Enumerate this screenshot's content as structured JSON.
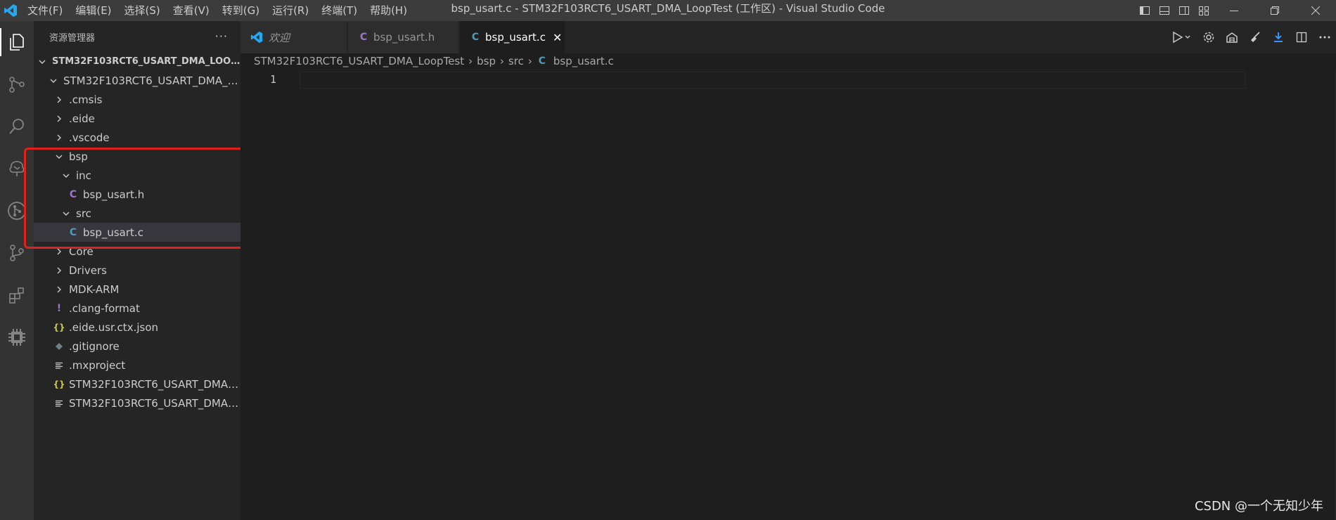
{
  "titlebar": {
    "menu": [
      "文件(F)",
      "编辑(E)",
      "选择(S)",
      "查看(V)",
      "转到(G)",
      "运行(R)",
      "终端(T)",
      "帮助(H)"
    ],
    "window_title": "bsp_usart.c - STM32F103RCT6_USART_DMA_LoopTest (工作区) - Visual Studio Code"
  },
  "sidebar": {
    "header": "资源管理器",
    "more": "···",
    "workspace_root": "STM32F103RCT6_USART_DMA_LOOPTE...",
    "folder_root": "STM32F103RCT6_USART_DMA_L...",
    "items": [
      {
        "label": ".cmsis",
        "type": "folder"
      },
      {
        "label": ".eide",
        "type": "folder"
      },
      {
        "label": ".vscode",
        "type": "folder"
      },
      {
        "label": "bsp",
        "type": "folder-open"
      },
      {
        "label": "inc",
        "type": "folder-open"
      },
      {
        "label": "bsp_usart.h",
        "type": "c-header",
        "icon_text": "C"
      },
      {
        "label": "src",
        "type": "folder-open"
      },
      {
        "label": "bsp_usart.c",
        "type": "c-source",
        "icon_text": "C"
      },
      {
        "label": "Core",
        "type": "folder"
      },
      {
        "label": "Drivers",
        "type": "folder"
      },
      {
        "label": "MDK-ARM",
        "type": "folder"
      },
      {
        "label": ".clang-format",
        "type": "file",
        "icon_text": "!"
      },
      {
        "label": ".eide.usr.ctx.json",
        "type": "json",
        "icon_text": "{}"
      },
      {
        "label": ".gitignore",
        "type": "git"
      },
      {
        "label": ".mxproject",
        "type": "text"
      },
      {
        "label": "STM32F103RCT6_USART_DMA_...",
        "type": "json",
        "icon_text": "{}"
      },
      {
        "label": "STM32F103RCT6_USART_DMA_...",
        "type": "text"
      }
    ]
  },
  "tabs": [
    {
      "label": "欢迎",
      "italic": true
    },
    {
      "label": "bsp_usart.h",
      "icon_text": "C"
    },
    {
      "label": "bsp_usart.c",
      "icon_text": "C",
      "active": true,
      "close": "✕"
    }
  ],
  "breadcrumb": [
    "STM32F103RCT6_USART_DMA_LoopTest",
    "bsp",
    "src",
    "bsp_usart.c"
  ],
  "breadcrumb_sep": "›",
  "breadcrumb_icon_text": "C",
  "editor": {
    "line_numbers": [
      "1"
    ]
  },
  "watermark": "CSDN @一个无知少年",
  "colors": {
    "c_header_icon": "#a074c4",
    "c_source_icon": "#519aba",
    "json_icon": "#cbcb41",
    "exclaim_icon": "#a074c4",
    "highlight": "#e0221b",
    "vscode_blue": "#23a9f2"
  }
}
